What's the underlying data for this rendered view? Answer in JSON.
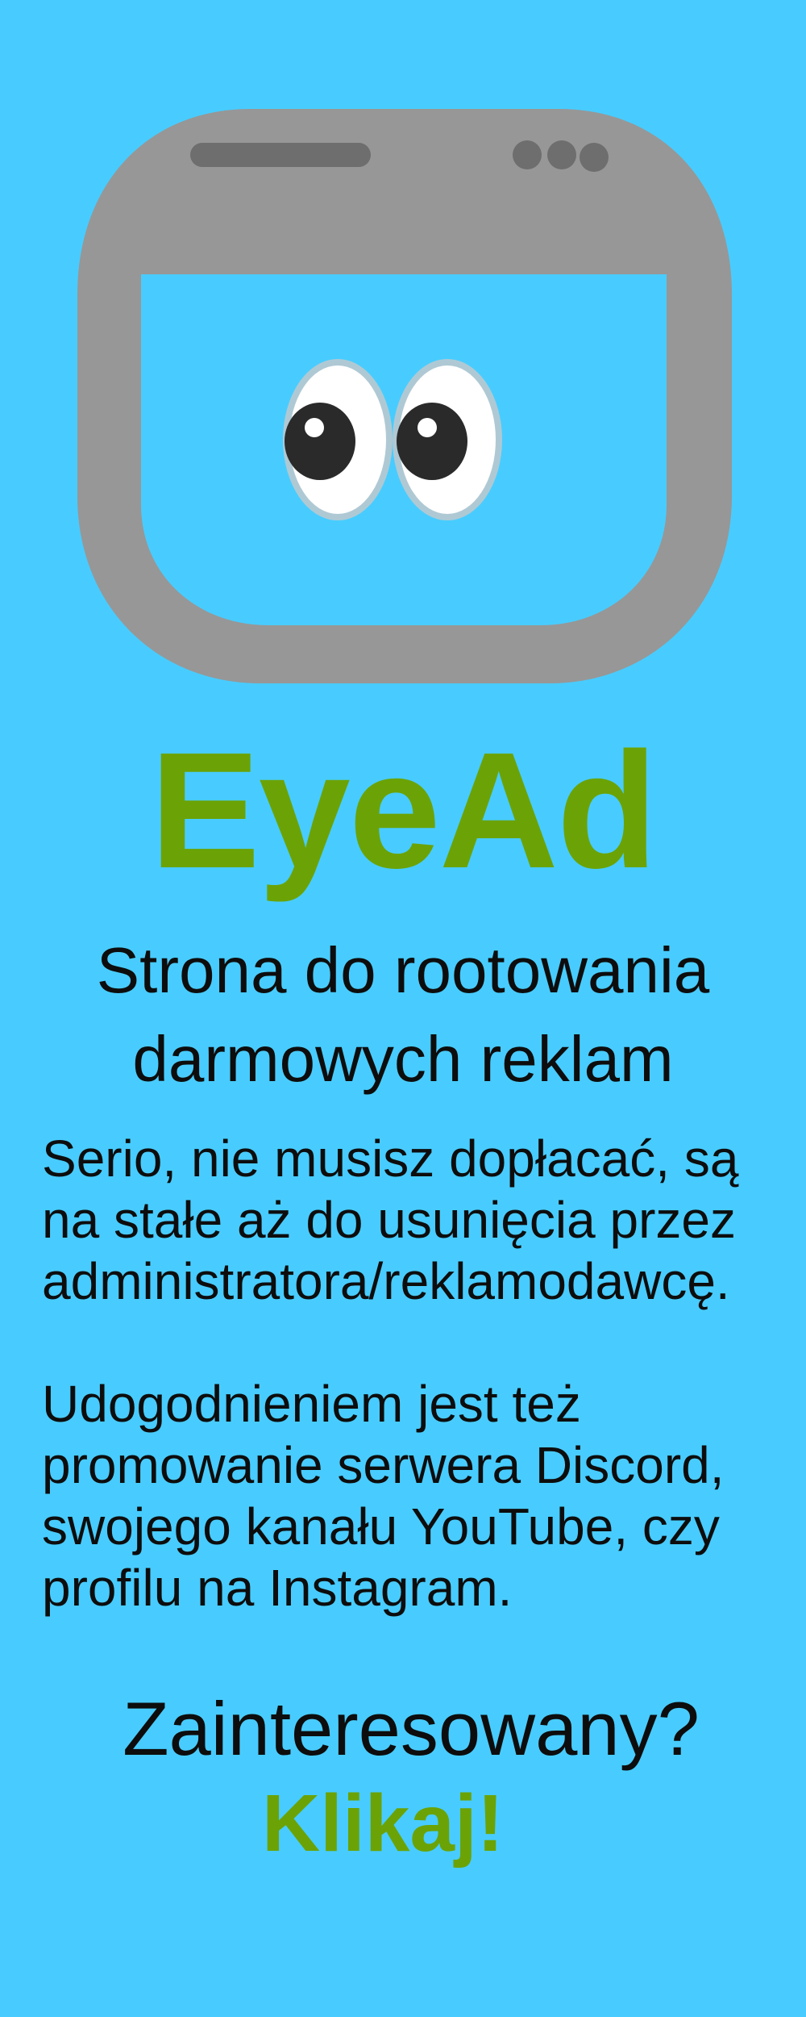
{
  "brand": {
    "name": "EyeAd",
    "accent_color": "#6BA306",
    "background_color": "#48CCFF",
    "logo_icon": "browser-window-with-eyes-icon"
  },
  "tagline": {
    "line1": "Strona do rootowania",
    "line2": "darmowych reklam"
  },
  "paragraph1": {
    "line1": "Serio, nie musisz dopłacać, są",
    "line2": "na stałe aż do usunięcia przez",
    "line3": "administratora/reklamodawcę."
  },
  "paragraph2": {
    "line1": "Udogodnieniem jest też",
    "line2": "promowanie serwera Discord,",
    "line3": "swojego kanału YouTube, czy",
    "line4": "profilu na Instagram."
  },
  "cta": {
    "question": "Zainteresowany?",
    "action": "Klikaj!"
  }
}
